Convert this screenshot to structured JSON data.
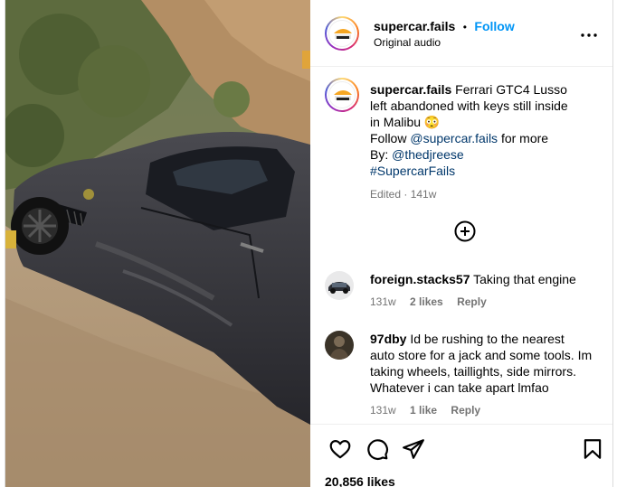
{
  "post": {
    "author": "supercar.fails",
    "separator": "•",
    "follow_label": "Follow",
    "audio": "Original audio",
    "more_label": "•••",
    "avatar_text": "SUPERCAR FAILS"
  },
  "caption": {
    "author": "supercar.fails",
    "text_line1": "Ferrari GTC4 Lusso",
    "text_line2": "left abandoned with keys still inside",
    "text_line3": "in Malibu",
    "emoji": "😳",
    "follow_prefix": "Follow ",
    "follow_handle": "@supercar.fails",
    "follow_suffix": " for more",
    "by_prefix": "By: ",
    "by_handle": "@thedjreese",
    "hashtag": "#SupercarFails",
    "edited": "Edited · 141w"
  },
  "comments": [
    {
      "author": "foreign.stacks57",
      "text": "Taking that engine",
      "time": "131w",
      "likes": "2 likes",
      "reply": "Reply"
    },
    {
      "author": "97dby",
      "text_line1": "Id be rushing to the nearest",
      "text_line2": "auto store for a jack and some tools. Im",
      "text_line3": "taking wheels, taillights, side mirrors.",
      "text_line4": "Whatever i can take apart lmfao",
      "time": "131w",
      "likes": "1 like",
      "reply": "Reply"
    }
  ],
  "footer": {
    "likes": "20,856 likes"
  },
  "colors": {
    "link_blue": "#0095f6",
    "mention_blue": "#00376b",
    "meta_gray": "#737373"
  },
  "icons": {
    "more": "more-icon",
    "load_more": "plus-circle-icon",
    "like": "heart-icon",
    "comment": "comment-icon",
    "share": "share-icon",
    "save": "bookmark-icon"
  }
}
